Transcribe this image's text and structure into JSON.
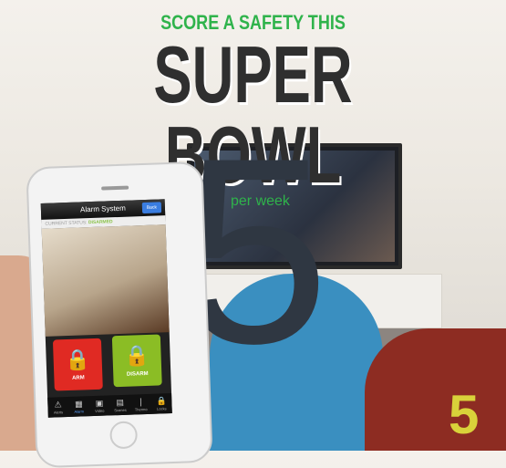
{
  "headline": {
    "kicker": "SCORE A SAFETY THIS",
    "title": "SUPER BOWL"
  },
  "price": {
    "currency": "$",
    "amount": "5",
    "period": "per week"
  },
  "jersey_number": "5",
  "phone": {
    "app_title": "Alarm System",
    "back_label": "Back",
    "status_label": "CURRENT STATUS:",
    "status_value": "DISARMED",
    "arm_label": "ARM",
    "disarm_label": "DISARM",
    "tabs": [
      {
        "label": "Alerts",
        "icon": "warning-icon"
      },
      {
        "label": "Alarm",
        "icon": "keypad-icon"
      },
      {
        "label": "Video",
        "icon": "video-icon"
      },
      {
        "label": "Scenes",
        "icon": "scenes-icon"
      },
      {
        "label": "Thermo",
        "icon": "thermometer-icon"
      },
      {
        "label": "Locks",
        "icon": "lock-icon"
      }
    ],
    "active_tab": "Alarm"
  },
  "colors": {
    "accent_green": "#2fb34b",
    "headline": "#2f2f2f",
    "price": "#2f3742",
    "arm": "#e02a23",
    "disarm": "#8bbd25"
  }
}
